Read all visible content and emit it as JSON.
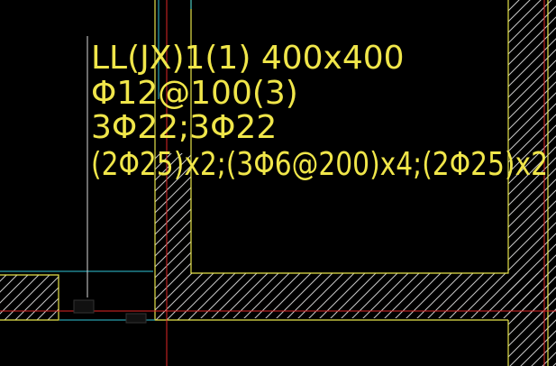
{
  "drawing": {
    "annotation_lines": [
      "LL(JX)1(1) 400x400",
      "Φ12@100(3)",
      "3Φ22;3Φ22",
      "(2Φ25)x2;(3Φ6@200)x4;(2Φ25)x2"
    ],
    "colors": {
      "background": "#000000",
      "wall_outline": "#e6e34a",
      "hatch": "#c9c9c9",
      "axis_line": "#e02626",
      "cyan_line": "#2fc3d6",
      "text": "#f0e64a"
    }
  }
}
